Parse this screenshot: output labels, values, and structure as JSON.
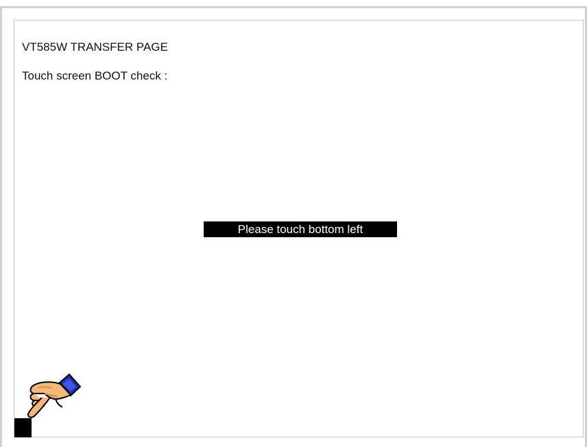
{
  "screen": {
    "title": "VT585W TRANSFER PAGE",
    "subtitle": "Touch screen BOOT check :",
    "prompt": "Please touch bottom left"
  },
  "icons": {
    "hand": "pointing-hand-icon",
    "target": "touch-target-marker"
  },
  "colors": {
    "prompt_bg": "#000000",
    "prompt_text": "#ffffff",
    "cuff": "#1a2fb0",
    "skin": "#f3b77a"
  }
}
